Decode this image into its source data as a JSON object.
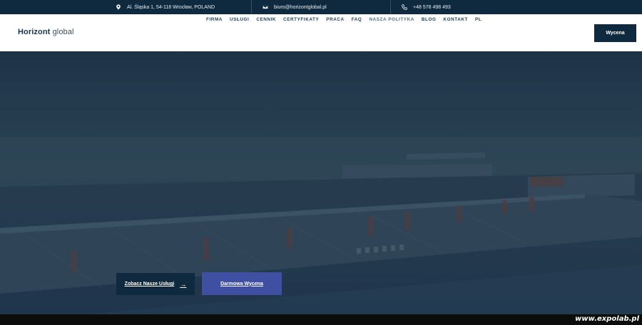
{
  "topbar": {
    "address": "Al. Śląska 1, 54-118 Wrocław, POLAND",
    "email": "biuro@horizontglobal.pl",
    "phone": "+48 578 498 493",
    "icons": [
      "location-pin-icon",
      "envelope-icon",
      "phone-icon"
    ]
  },
  "header": {
    "logo_strong": "Horizont",
    "logo_light": "global",
    "nav": [
      {
        "label": "FIRMA"
      },
      {
        "label": "USŁUGI"
      },
      {
        "label": "CENNIK"
      },
      {
        "label": "CERTYFIKATY"
      },
      {
        "label": "PRACA"
      },
      {
        "label": "FAQ"
      },
      {
        "label": "NASZA POLITYKA",
        "active": true
      },
      {
        "label": "BLOG"
      },
      {
        "label": "KONTAKT"
      },
      {
        "label": "PL"
      }
    ],
    "quote_button": "Wycena"
  },
  "hero": {
    "primary_button": "Zobacz Nasze Usługi",
    "secondary_button": "Darmowa Wycena"
  },
  "watermark": "www.expolab.pl",
  "colors": {
    "navy": "#0f2a3f",
    "accent_blue": "#3f50a2",
    "white": "#ffffff"
  }
}
